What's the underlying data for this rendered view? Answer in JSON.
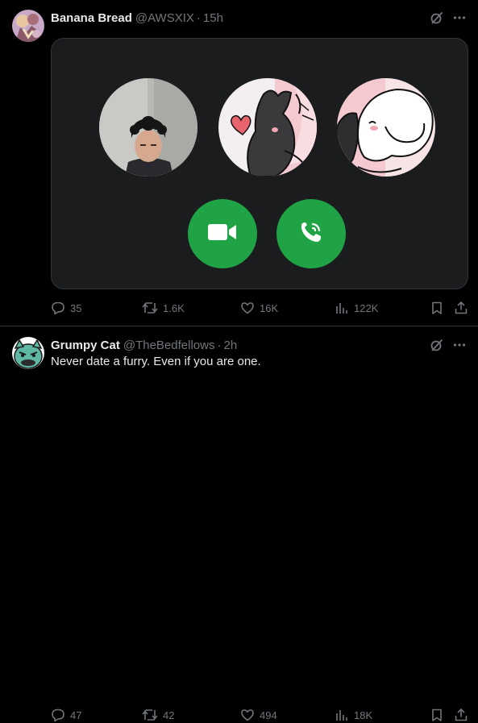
{
  "colors": {
    "background": "#000000",
    "text_primary": "#e7e9ea",
    "text_secondary": "#71767b",
    "divider": "#2f3336",
    "call_button_green": "#1fa345",
    "media_card": "#1b1c1e"
  },
  "tweets": [
    {
      "display_name": "Banana Bread",
      "handle": "@AWSXIX",
      "separator": "·",
      "time": "15h",
      "more_icon": "more-horizontal-icon",
      "grok_icon": "grok-slash-icon",
      "media": {
        "participants": [
          "person-photo",
          "dark-bunny-heart-illustration",
          "white-bunny-illustration"
        ],
        "buttons": [
          {
            "icon": "video-camera-icon"
          },
          {
            "icon": "phone-call-icon"
          }
        ]
      },
      "stats": {
        "replies": "35",
        "reposts": "1.6K",
        "likes": "16K",
        "views": "122K"
      }
    },
    {
      "display_name": "Grumpy Cat",
      "handle": "@TheBedfellows",
      "separator": "·",
      "time": "2h",
      "text": "Never date a furry. Even if you are one.",
      "more_icon": "more-horizontal-icon",
      "grok_icon": "grok-slash-icon",
      "stats": {
        "replies": "47",
        "reposts": "42",
        "likes": "494",
        "views": "18K"
      }
    }
  ]
}
